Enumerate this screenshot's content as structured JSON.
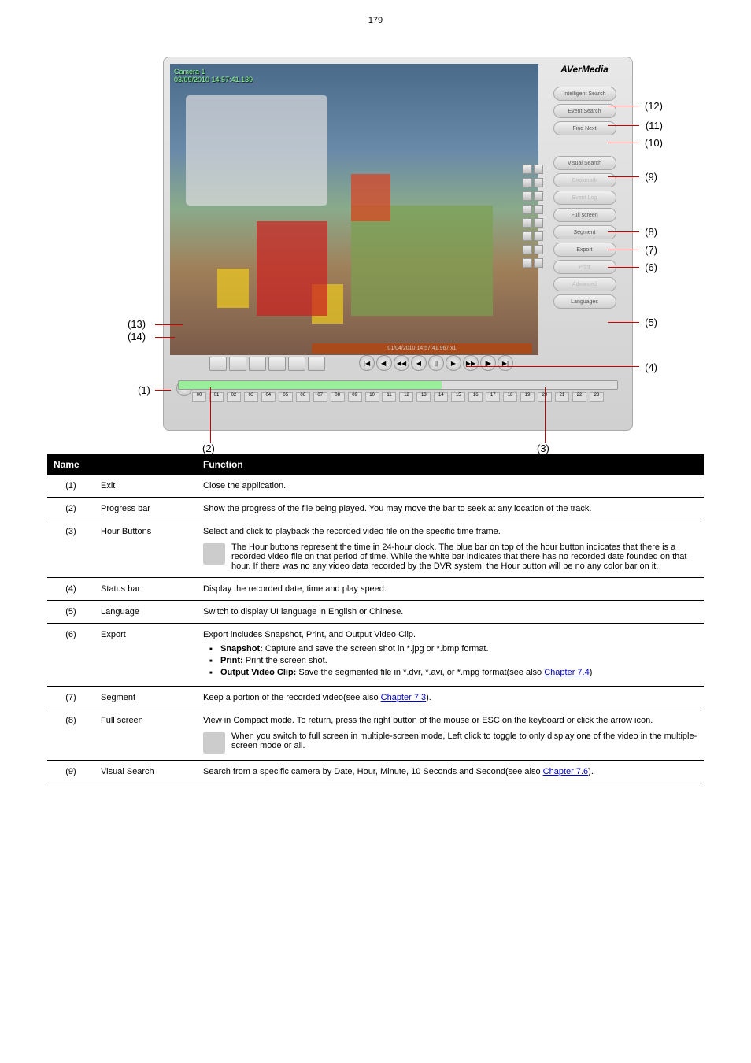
{
  "page_number": "179",
  "dvr": {
    "brand": "AVerMedia",
    "camera_overlay": "Camera 1\n03/09/2010 14:57:41.139",
    "status_bar": "01/04/2010 14:57:41.967  x1",
    "side_buttons": [
      "Intelligent Search",
      "Event Search",
      "Find Next",
      "Visual Search",
      "Bookmark",
      "Event Log",
      "Full screen",
      "Segment",
      "Export",
      "Print",
      "Advanced",
      "Languages"
    ],
    "hours": [
      "00",
      "01",
      "02",
      "03",
      "04",
      "05",
      "06",
      "07",
      "08",
      "09",
      "10",
      "11",
      "12",
      "13",
      "14",
      "15",
      "16",
      "17",
      "18",
      "19",
      "20",
      "21",
      "22",
      "23"
    ]
  },
  "callouts": {
    "c1": "(1)",
    "c2": "(2)",
    "c3": "(3)",
    "c4": "(4)",
    "c5": "(5)",
    "c6": "(6)",
    "c7": "(7)",
    "c8": "(8)",
    "c9": "(9)",
    "c10": "(10)",
    "c11": "(11)",
    "c12": "(12)",
    "c13": "(13)",
    "c14": "(14)"
  },
  "table": {
    "header_name": "Name",
    "header_function": "Function",
    "rows": [
      {
        "num": "(1)",
        "name": "Exit",
        "func": "Close the application."
      },
      {
        "num": "(2)",
        "name": "Progress bar",
        "func": "Show the progress of the file being played. You may move the bar to seek at any location of the track."
      },
      {
        "num": "(3)",
        "name": "Hour Buttons",
        "func": "Select and click to playback the recorded video file on the specific time frame.",
        "note_prefix": "The Hour buttons represent the time in 24-hour clock. The blue bar on top of the hour button indicates that there is a recorded video file on that period of time. While the white bar indicates that there has no recorded date founded on that hour. If there was no any video data recorded by the DVR system, the Hour button will be no any color bar on it."
      },
      {
        "num": "(4)",
        "name": "Status bar",
        "func": "Display the recorded date, time and play speed."
      },
      {
        "num": "(5)",
        "name": "Language",
        "func": "Switch to display UI language in English or Chinese."
      },
      {
        "num": "(6)",
        "name": "Export",
        "func_lead": "Export includes Snapshot, Print, and Output Video Clip.",
        "bullets": [
          "Snapshot: Capture and save the screen shot in *.jpg or *.bmp format.",
          "Print: Print the screen shot.",
          "Output Video Clip: Save the segmented file in *.dvr, *.avi, or *.mpg format"
        ],
        "see_also_prefix": "(see also ",
        "see_also_link": "Chapter 7.4",
        "see_also_suffix": ")"
      },
      {
        "num": "(7)",
        "name": "Segment",
        "func_prefix": "Keep a portion of the recorded video(see also ",
        "func_link": "Chapter 7.3",
        "func_suffix": ")."
      },
      {
        "num": "(8)",
        "name": "Full screen",
        "func": "View in Compact mode. To return, press the right button of the mouse or ESC on the keyboard or click the arrow icon.",
        "note": "When you switch to full screen in multiple-screen mode, Left click to toggle to only display one of the video in the multiple-screen mode or all."
      },
      {
        "num": "(9)",
        "name": "Visual Search",
        "func_prefix": "Search from a specific camera by Date, Hour, Minute, 10 Seconds and Second(see also ",
        "func_link": "Chapter 7.6",
        "func_suffix": ")."
      }
    ]
  }
}
